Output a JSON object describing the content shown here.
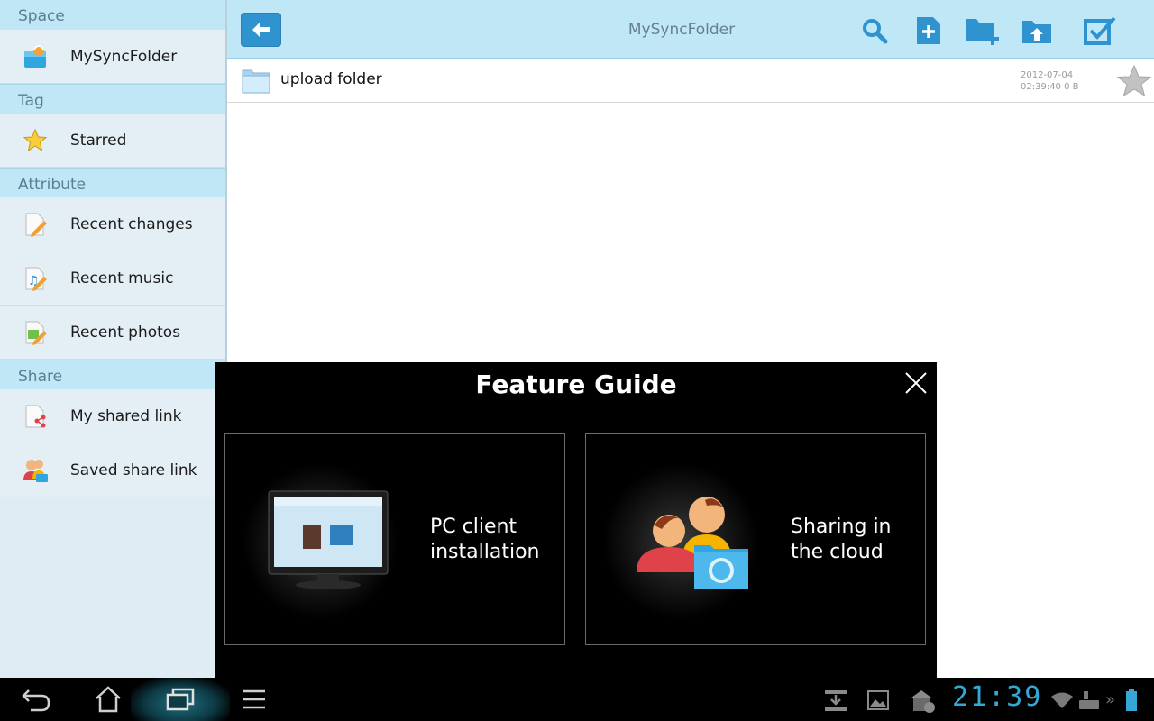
{
  "sidebar": {
    "sections": [
      {
        "header": "Space",
        "items": [
          {
            "label": "MySyncFolder",
            "icon": "sync-folder-icon"
          }
        ]
      },
      {
        "header": "Tag",
        "items": [
          {
            "label": "Starred",
            "icon": "star-icon"
          }
        ]
      },
      {
        "header": "Attribute",
        "items": [
          {
            "label": "Recent changes",
            "icon": "recent-changes-icon"
          },
          {
            "label": "Recent music",
            "icon": "recent-music-icon"
          },
          {
            "label": "Recent photos",
            "icon": "recent-photos-icon"
          }
        ]
      },
      {
        "header": "Share",
        "items": [
          {
            "label": "My shared link",
            "icon": "shared-link-icon"
          },
          {
            "label": "Saved share link",
            "icon": "saved-share-link-icon"
          }
        ]
      }
    ]
  },
  "topbar": {
    "title": "MySyncFolder",
    "actions": [
      "search-icon",
      "new-file-icon",
      "new-folder-icon",
      "upload-icon",
      "select-icon"
    ]
  },
  "files": [
    {
      "name": "upload folder",
      "date": "2012-07-04",
      "time_size": "02:39:40 0 B",
      "starred": false
    }
  ],
  "dialog": {
    "title": "Feature Guide",
    "cards": [
      {
        "line1": "PC client",
        "line2": "installation",
        "icon": "pc-monitor-icon"
      },
      {
        "line1": "Sharing in",
        "line2": "the cloud",
        "icon": "cloud-sharing-icon"
      }
    ]
  },
  "system_bar": {
    "clock": "21:39"
  },
  "colors": {
    "accent": "#2f93cf",
    "header_bg": "#bfe7f5",
    "sidebar_bg": "#e4eff5",
    "clock": "#35a7d5"
  }
}
